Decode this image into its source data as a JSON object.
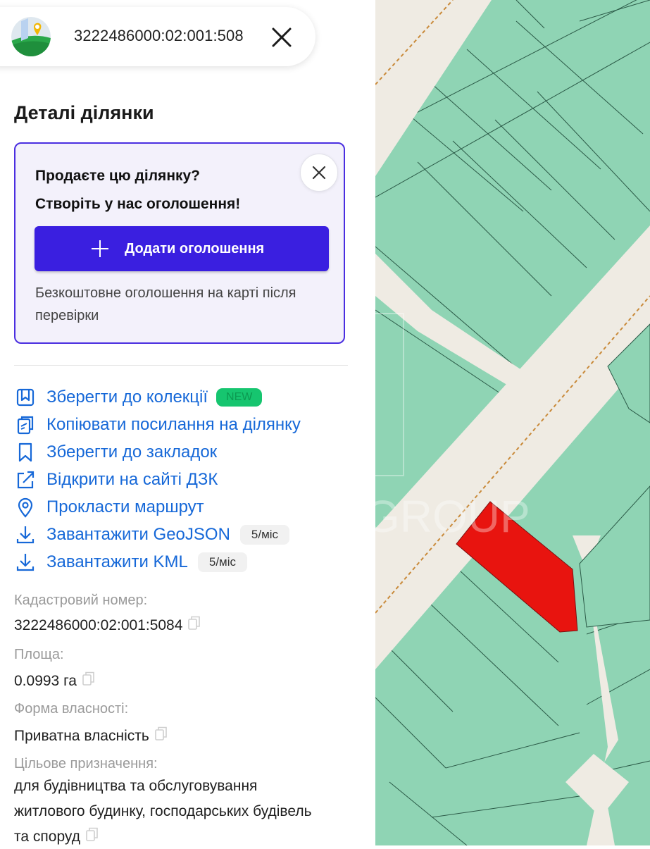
{
  "search": {
    "cadastral_query": "3222486000:02:001:508"
  },
  "panel": {
    "title": "Деталі ділянки"
  },
  "promo": {
    "heading_line1": "Продаєте цю ділянку?",
    "heading_line2": "Створіть у нас оголошення!",
    "button_label": "Додати оголошення",
    "note": "Безкоштовне оголошення на карті після перевірки"
  },
  "actions": [
    {
      "label": "Зберегти до колекції",
      "icon": "collection-icon",
      "badge": "NEW"
    },
    {
      "label": "Копіювати посилання на ділянку",
      "icon": "copy-link-icon"
    },
    {
      "label": "Зберегти до закладок",
      "icon": "bookmark-icon"
    },
    {
      "label": "Відкрити на сайті ДЗК",
      "icon": "external-link-icon"
    },
    {
      "label": "Прокласти маршрут",
      "icon": "location-pin-icon"
    },
    {
      "label": "Завантажити GeoJSON",
      "icon": "download-icon",
      "limit": "5/міс"
    },
    {
      "label": "Завантажити KML",
      "icon": "download-icon",
      "limit": "5/міс"
    }
  ],
  "properties": [
    {
      "label": "Кадастровий номер:",
      "value": "3222486000:02:001:5084"
    },
    {
      "label": "Площа:",
      "value": "0.0993 га"
    },
    {
      "label": "Форма власності:",
      "value": "Приватна власність"
    },
    {
      "label": "Цільове призначення:",
      "value_lines": [
        "для будівництва та обслуговування",
        "житлового будинку, господарських будівель",
        "та споруд"
      ]
    }
  ],
  "map": {
    "watermark": "GROUP",
    "highlight_color": "#e8140f",
    "parcel_color": "#8fd4b4",
    "road_color": "#efebe3"
  }
}
